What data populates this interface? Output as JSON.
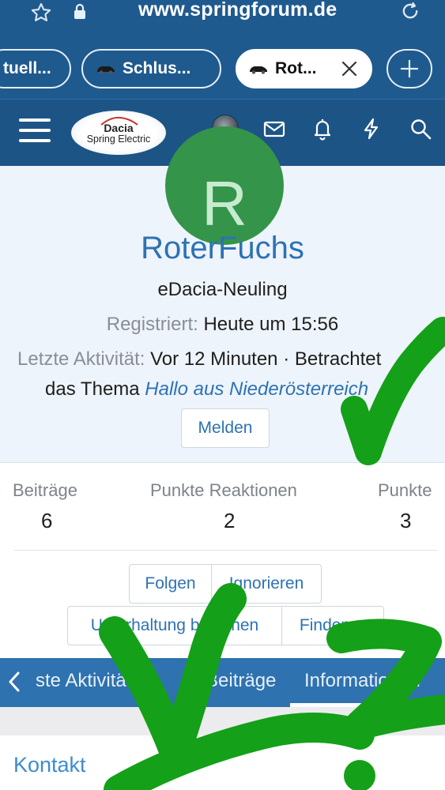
{
  "browser": {
    "url": "www.springforum.de",
    "tabs": [
      {
        "label": "tuell..."
      },
      {
        "label": "Schlus..."
      },
      {
        "label": "Rot..."
      }
    ]
  },
  "site": {
    "logo_line1": "Dacia",
    "logo_line2": "Spring Electric"
  },
  "profile": {
    "name": "RoterFuchs",
    "avatar_letter": "R",
    "user_title": "eDacia-Neuling",
    "registered_label": "Registriert:",
    "registered_value": "Heute um 15:56",
    "activity_label": "Letzte Aktivität:",
    "activity_value": "Vor 12 Minuten · Betrachtet",
    "activity_prefix": "das Thema",
    "activity_link": "Hallo aus Niederösterreich",
    "report_button": "Melden"
  },
  "stats": [
    {
      "label": "Beiträge",
      "value": "6"
    },
    {
      "label": "Punkte Reaktionen",
      "value": "2"
    },
    {
      "label": "Punkte",
      "value": "3"
    }
  ],
  "actions": {
    "follow": "Folgen",
    "ignore": "Ignorieren",
    "start_conversation": "Unterhaltung beginnen",
    "find": "Finden"
  },
  "profile_tabs": [
    {
      "label": "ste Aktivität"
    },
    {
      "label": "Beiträge"
    },
    {
      "label": "Informationen"
    }
  ],
  "contact": {
    "heading": "Kontakt"
  },
  "colors": {
    "header_blue": "#1d5486",
    "link_blue": "#2d72b3",
    "avatar_green": "#34944a",
    "overlay_green": "#14a018"
  },
  "icons": {
    "mail": "mail-icon",
    "alerts": "bell-icon",
    "whats_new": "bolt-icon",
    "search": "search-icon"
  }
}
